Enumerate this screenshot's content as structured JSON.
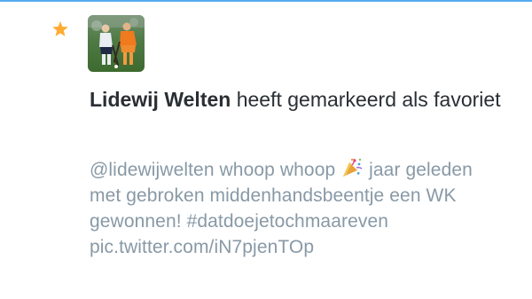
{
  "colors": {
    "accent": "#55acee",
    "star": "#ffac33",
    "primary_text": "#292f33",
    "secondary_text": "#8899a6"
  },
  "notification": {
    "icon": "star-icon",
    "avatar": "avatar-hockey-player",
    "actor_name": "Lidewij Welten",
    "action_text": "heeft gemarkeerd als favoriet"
  },
  "tweet": {
    "mention": "@lidewijwelten",
    "text_before_emoji": "whoop whoop",
    "emoji": "party-popper-icon",
    "text_after_emoji": "jaar geleden met gebroken middenhandsbeentje een WK gewonnen! #datdoejetochmaareven",
    "link": "pic.twitter.com/​iN7pjenTOp"
  }
}
